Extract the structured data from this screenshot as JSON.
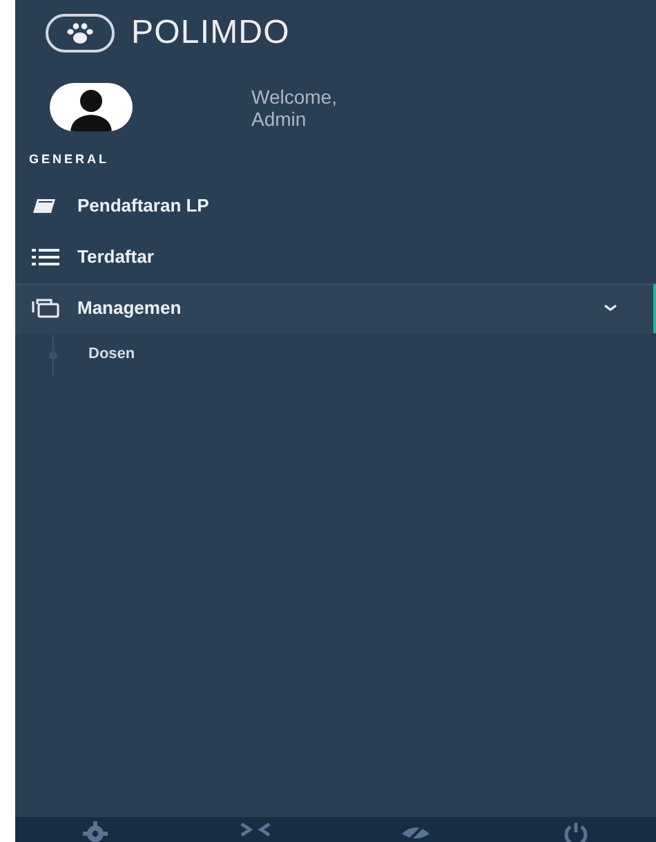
{
  "brand": {
    "title": "POLIMDO"
  },
  "profile": {
    "greeting": "Welcome,",
    "name": "Admin"
  },
  "section": {
    "title": "GENERAL"
  },
  "menu": [
    {
      "kind": "form",
      "label": "Pendaftaran LP",
      "selected": false
    },
    {
      "kind": "list",
      "label": "Terdaftar",
      "selected": false
    },
    {
      "kind": "group",
      "label": "Managemen",
      "selected": true,
      "expanded": true,
      "children": [
        {
          "label": "Dosen",
          "selected": false
        }
      ]
    }
  ],
  "footer": {
    "icons": [
      {
        "kind": "settings"
      },
      {
        "kind": "fullscreen"
      },
      {
        "kind": "hide"
      },
      {
        "kind": "power"
      }
    ]
  }
}
